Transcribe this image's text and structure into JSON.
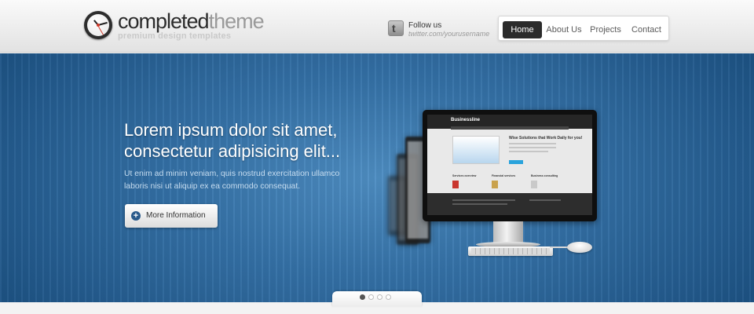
{
  "header": {
    "logo": {
      "bold": "completed",
      "light": "theme",
      "tagline": "premium design templates"
    },
    "follow": {
      "title": "Follow us",
      "handle": "twitter.com/yourusername",
      "icon": "twitter-icon"
    },
    "nav": [
      "Home",
      "About Us",
      "Projects",
      "Contact"
    ],
    "active_nav": "Home"
  },
  "hero": {
    "title_line1": "Lorem ipsum dolor sit amet,",
    "title_line2": "consectetur adipisicing elit...",
    "text_line1": "Ut enim ad minim veniam, quis nostrud exercitation ullamco",
    "text_line2": "laboris nisi ut aliquip ex ea commodo consequat.",
    "button_label": "More Information",
    "button_icon": "plus-circle-icon"
  },
  "screen": {
    "logo": "Businessline",
    "headline": "Wise Solutions that Work Daily for you!",
    "columns": [
      "Services overview",
      "Financial services",
      "Business consulting"
    ]
  },
  "slider": {
    "total": 4,
    "active": 1
  },
  "colors": {
    "accent": "#2b2b2b",
    "hero_blue": "#3572a8",
    "screen_button": "#29a3dc"
  }
}
